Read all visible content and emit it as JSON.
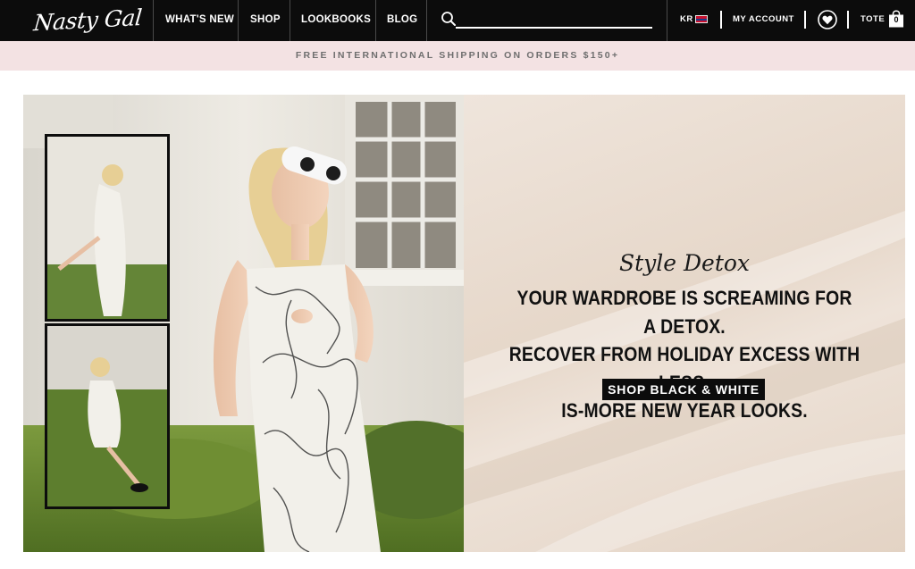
{
  "brand": {
    "logo_text": "Nasty Gal"
  },
  "nav": {
    "items": [
      {
        "label": "WHAT'S NEW"
      },
      {
        "label": "SHOP"
      },
      {
        "label": "LOOKBOOKS"
      },
      {
        "label": "BLOG"
      }
    ]
  },
  "search": {
    "placeholder": "",
    "icon": "search-icon"
  },
  "utility": {
    "locale_label": "KR",
    "account_label": "MY ACCOUNT",
    "wishlist_icon": "heart-icon",
    "tote_label": "TOTE",
    "tote_count": "0"
  },
  "promo": {
    "text": "FREE INTERNATIONAL SHIPPING ON ORDERS $150+"
  },
  "hero": {
    "kicker": "Style Detox",
    "headline_lines": [
      "YOUR WARDROBE IS SCREAMING FOR A DETOX.",
      "RECOVER FROM HOLIDAY EXCESS WITH LESS-",
      "IS-MORE NEW YEAR LOOKS."
    ],
    "cta_label": "SHOP BLACK & WHITE"
  },
  "colors": {
    "nav_bg": "#0c0c0c",
    "promo_bg": "#f3e2e3",
    "promo_text": "#6e6e6e",
    "panel_bg": "#ebdfd4",
    "cta_bg": "#0c0c0c"
  }
}
